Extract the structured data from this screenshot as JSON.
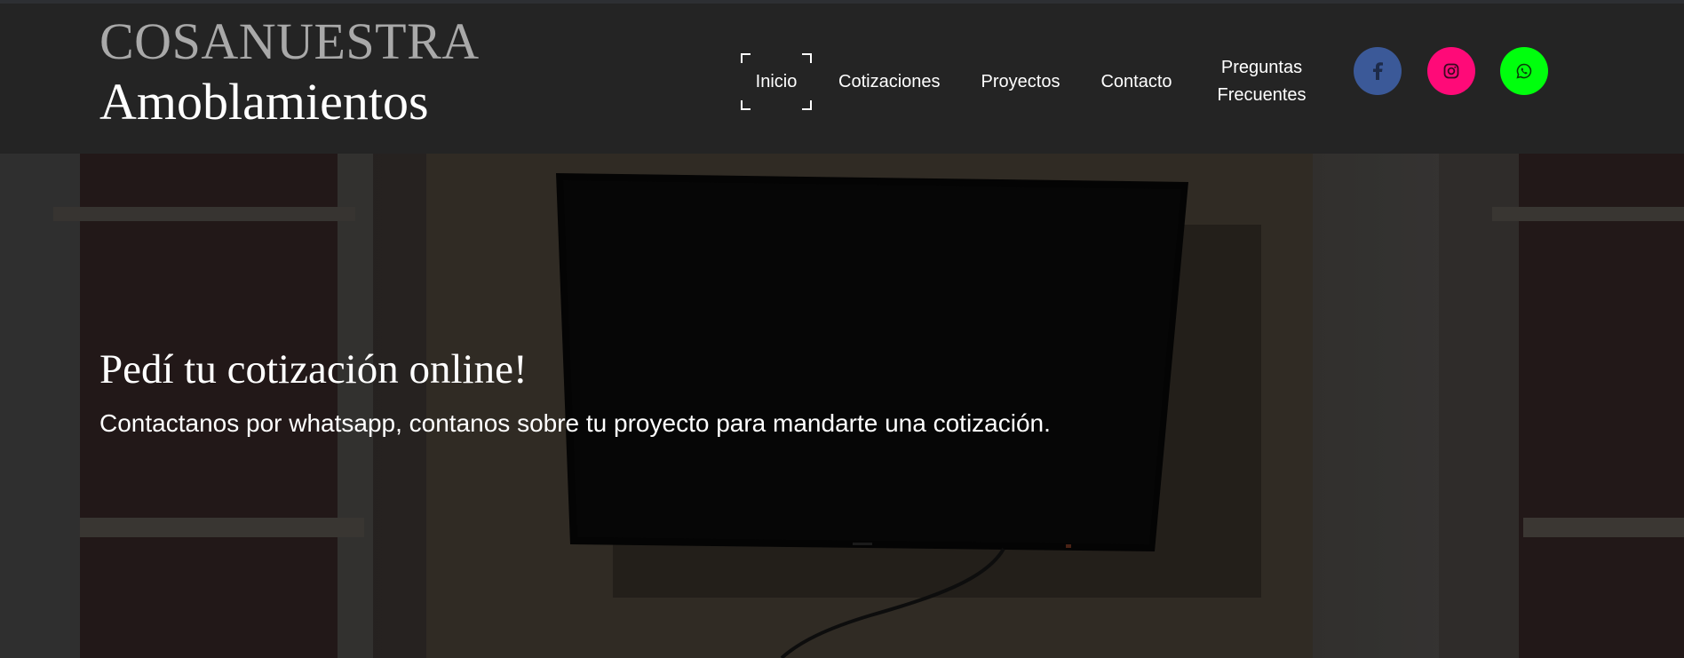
{
  "brand": {
    "line1": "COSANUESTRA",
    "line2": "Amoblamientos"
  },
  "nav": {
    "items": [
      {
        "label": "Inicio",
        "active": true
      },
      {
        "label": "Cotizaciones",
        "active": false
      },
      {
        "label": "Proyectos",
        "active": false
      },
      {
        "label": "Contacto",
        "active": false
      },
      {
        "label": "Preguntas Frecuentes",
        "active": false
      }
    ]
  },
  "social": [
    {
      "icon": "facebook-icon",
      "color": "#3b5998"
    },
    {
      "icon": "instagram-icon",
      "color": "#ff0a78"
    },
    {
      "icon": "whatsapp-icon",
      "color": "#00ff0d"
    }
  ],
  "hero": {
    "title": "Pedí tu cotización online!",
    "subtitle": "Contactanos por whatsapp, contanos sobre tu proyecto para mandarte una cotización."
  },
  "colors": {
    "header_bg": "#242424",
    "brand_grey": "#a9a9a9",
    "text": "#ffffff"
  }
}
